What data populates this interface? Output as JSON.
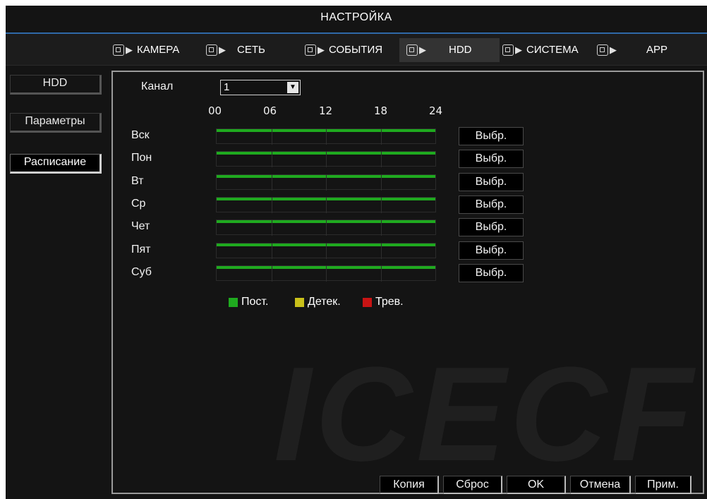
{
  "title": "НАСТРОЙКА",
  "tabs": [
    {
      "label": "КАМЕРА",
      "icon": "camera-icon"
    },
    {
      "label": "СЕТЬ",
      "icon": "network-icon"
    },
    {
      "label": "СОБЫТИЯ",
      "icon": "events-icon"
    },
    {
      "label": "HDD",
      "icon": "hdd-icon",
      "active": true
    },
    {
      "label": "СИСТЕМА",
      "icon": "system-icon"
    },
    {
      "label": "APP",
      "icon": "app-icon"
    }
  ],
  "sidebar": {
    "items": [
      {
        "label": "HDD"
      },
      {
        "label": "Параметры"
      },
      {
        "label": "Расписание",
        "selected": true
      }
    ]
  },
  "channel": {
    "label": "Канал",
    "value": "1"
  },
  "hours": [
    "00",
    "06",
    "12",
    "18",
    "24"
  ],
  "days": [
    {
      "label": "Вск",
      "button": "Выбр.",
      "coverage": 1.0
    },
    {
      "label": "Пон",
      "button": "Выбр.",
      "coverage": 1.0
    },
    {
      "label": "Вт",
      "button": "Выбр.",
      "coverage": 1.0
    },
    {
      "label": "Ср",
      "button": "Выбр.",
      "coverage": 1.0
    },
    {
      "label": "Чет",
      "button": "Выбр.",
      "coverage": 1.0
    },
    {
      "label": "Пят",
      "button": "Выбр.",
      "coverage": 1.0
    },
    {
      "label": "Суб",
      "button": "Выбр.",
      "coverage": 1.0
    }
  ],
  "legend": [
    {
      "label": "Пост.",
      "color": "#1faa1f"
    },
    {
      "label": "Детек.",
      "color": "#c9c01a"
    },
    {
      "label": "Трев.",
      "color": "#c81414"
    }
  ],
  "buttons": {
    "copy": "Копия",
    "reset": "Сброс",
    "ok": "OK",
    "cancel": "Отмена",
    "apply": "Прим."
  },
  "watermark": "ICECF"
}
